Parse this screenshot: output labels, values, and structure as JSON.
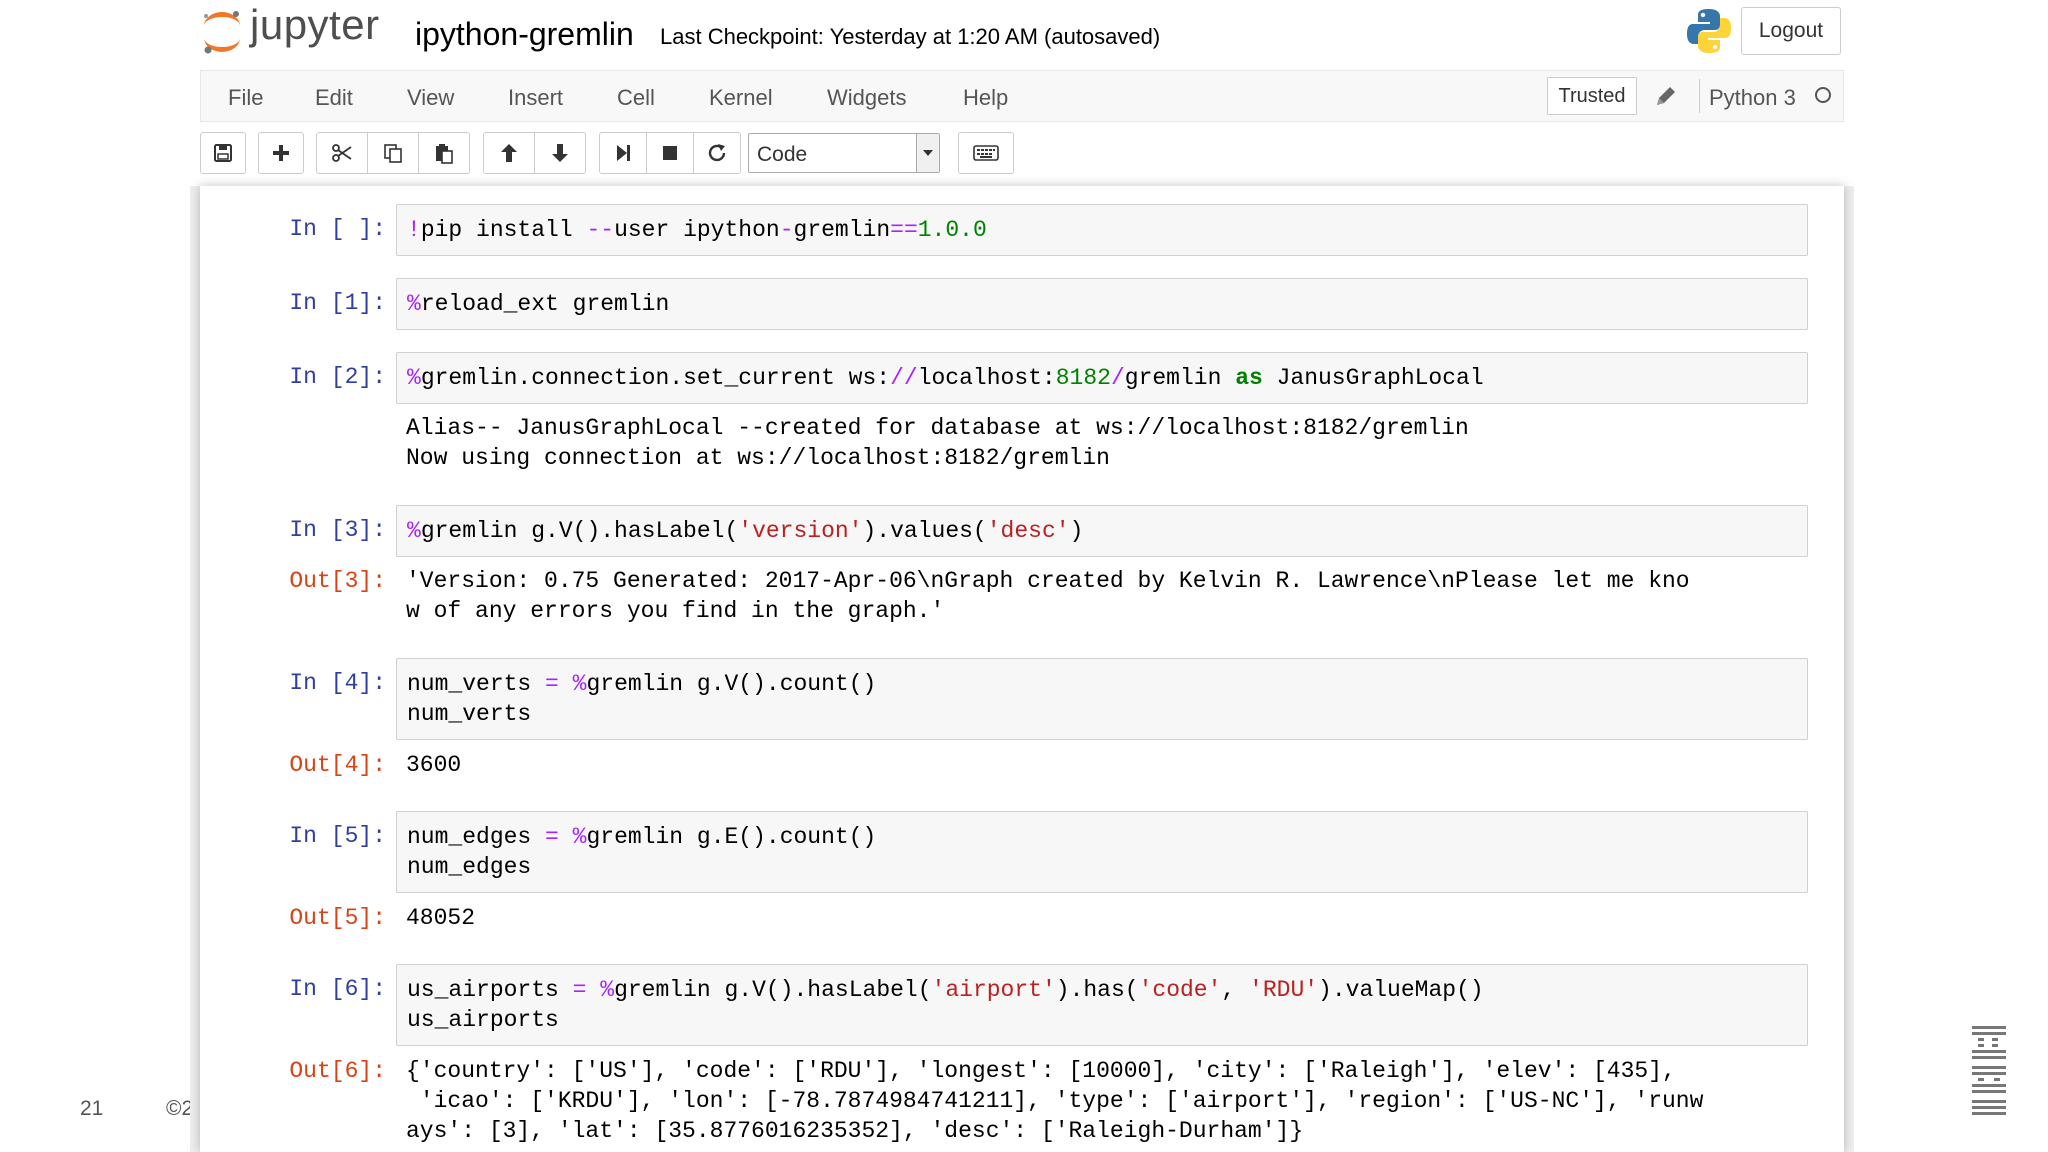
{
  "header": {
    "logo_text": "jupyter",
    "notebook_name": "ipython-gremlin",
    "checkpoint": "Last Checkpoint: Yesterday at 1:20 AM (autosaved)",
    "logout_label": "Logout"
  },
  "menubar": {
    "items": [
      "File",
      "Edit",
      "View",
      "Insert",
      "Cell",
      "Kernel",
      "Widgets",
      "Help"
    ],
    "trusted_label": "Trusted",
    "kernel_name": "Python 3"
  },
  "toolbar": {
    "cell_type": "Code",
    "buttons": [
      "save-icon",
      "plus-icon",
      "scissors-icon",
      "copy-icon",
      "paste-icon",
      "arrow-up-icon",
      "arrow-down-icon",
      "step-forward-icon",
      "stop-icon",
      "refresh-icon",
      "keyboard-icon"
    ]
  },
  "cells": [
    {
      "in_prompt": "In [ ]:",
      "code": [
        "!pip install --user ipython-gremlin==1.0.0"
      ],
      "out_prompt": "",
      "output": []
    },
    {
      "in_prompt": "In [1]:",
      "code": [
        "%reload_ext gremlin"
      ],
      "out_prompt": "",
      "output": []
    },
    {
      "in_prompt": "In [2]:",
      "code": [
        "%gremlin.connection.set_current ws://localhost:8182/gremlin as JanusGraphLocal"
      ],
      "out_prompt": "",
      "output": [
        "Alias-- JanusGraphLocal --created for database at ws://localhost:8182/gremlin",
        "Now using connection at ws://localhost:8182/gremlin"
      ]
    },
    {
      "in_prompt": "In [3]:",
      "code": [
        "%gremlin g.V().hasLabel('version').values('desc')"
      ],
      "out_prompt": "Out[3]:",
      "output": [
        "'Version: 0.75 Generated: 2017-Apr-06\\nGraph created by Kelvin R. Lawrence\\nPlease let me kno",
        "w of any errors you find in the graph.'"
      ]
    },
    {
      "in_prompt": "In [4]:",
      "code": [
        "num_verts = %gremlin g.V().count()",
        "num_verts"
      ],
      "out_prompt": "Out[4]:",
      "output": [
        "3600"
      ]
    },
    {
      "in_prompt": "In [5]:",
      "code": [
        "num_edges = %gremlin g.E().count()",
        "num_edges"
      ],
      "out_prompt": "Out[5]:",
      "output": [
        "48052"
      ]
    },
    {
      "in_prompt": "In [6]:",
      "code": [
        "us_airports = %gremlin g.V().hasLabel('airport').has('code', 'RDU').valueMap()",
        "us_airports"
      ],
      "out_prompt": "Out[6]:",
      "output": [
        "{'country': ['US'], 'code': ['RDU'], 'longest': [10000], 'city': ['Raleigh'], 'elev': [435],",
        " 'icao': ['KRDU'], 'lon': [-78.7874984741211], 'type': ['airport'], 'region': ['US-NC'], 'runw",
        "ays': [3], 'lat': [35.8776016235352], 'desc': ['Raleigh-Durham']}"
      ]
    }
  ],
  "slide": {
    "page_number": "21",
    "copyright_fragment": "©2"
  }
}
